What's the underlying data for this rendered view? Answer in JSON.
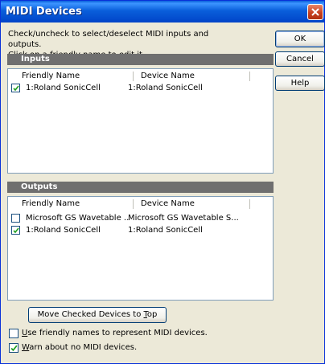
{
  "window": {
    "title": "MIDI Devices"
  },
  "instructions": {
    "line1": "Check/uncheck to select/deselect MIDI inputs and outputs.",
    "line2": "Click on a friendly name to edit it."
  },
  "inputs": {
    "header": "Inputs",
    "columns": [
      "Friendly Name",
      "Device Name"
    ],
    "rows": [
      {
        "friendly": "1:Roland SonicCell",
        "device": "1:Roland SonicCell",
        "checked": true
      }
    ]
  },
  "outputs": {
    "header": "Outputs",
    "columns": [
      "Friendly Name",
      "Device Name"
    ],
    "rows": [
      {
        "friendly": "Microsoft GS Wavetable ...",
        "device": "Microsoft GS Wavetable S...",
        "checked": false
      },
      {
        "friendly": "1:Roland SonicCell",
        "device": "1:Roland SonicCell",
        "checked": true
      }
    ]
  },
  "buttons": {
    "ok": "OK",
    "cancel": "Cancel",
    "help": "Help",
    "move_pre": "Move Checked Devices to ",
    "move_key": "T",
    "move_post": "op"
  },
  "options": {
    "friendly_key": "U",
    "friendly_rest": "se friendly names to represent MIDI devices.",
    "friendly_checked": false,
    "warn_key": "W",
    "warn_rest": "arn about no MIDI devices.",
    "warn_checked": true
  },
  "colors": {
    "titlebar": "#0A5FDB",
    "dialog_bg": "#ECE9D8",
    "group_header": "#6F6F6F",
    "check_mark": "#21A121"
  },
  "icons": {
    "close": "close-icon",
    "checkmark": "checkmark-icon"
  }
}
